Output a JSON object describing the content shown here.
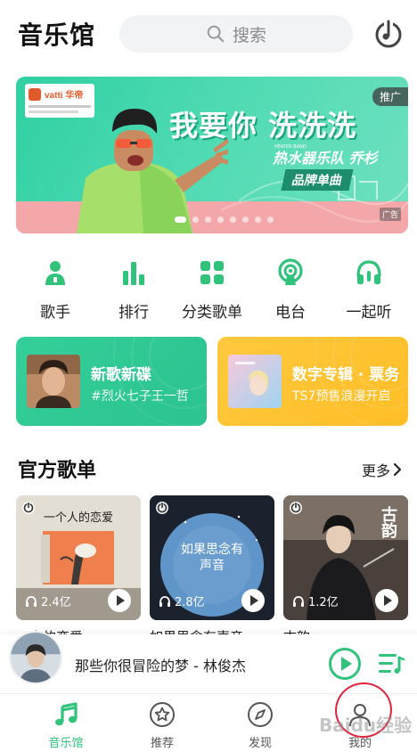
{
  "header": {
    "title": "音乐馆",
    "search_placeholder": "搜索",
    "search_icon": "search-icon",
    "recognize_icon": "music-recognize-icon"
  },
  "banner": {
    "brand": "vatti 华帝",
    "headline": "我要你 洗洗洗",
    "subline": "热水器乐队 乔杉",
    "subline_small": "HEATER BAND",
    "ribbon": "品牌单曲",
    "promo_tag": "推广",
    "ad_tag": "广告",
    "total_slides": 8,
    "active_slide": 0
  },
  "shortcuts": [
    {
      "label": "歌手",
      "icon": "singer-icon"
    },
    {
      "label": "排行",
      "icon": "ranking-icon"
    },
    {
      "label": "分类歌单",
      "icon": "category-icon"
    },
    {
      "label": "电台",
      "icon": "radio-icon"
    },
    {
      "label": "一起听",
      "icon": "listen-together-icon"
    }
  ],
  "features": [
    {
      "title": "新歌新碟",
      "subtitle": "#烈火七子王一哲",
      "color": "#2fc994"
    },
    {
      "title": "数字专辑 · 票务",
      "subtitle": "TS7预售浪漫开启",
      "color": "#ffc530"
    }
  ],
  "official_playlists": {
    "title": "官方歌单",
    "more": "更多",
    "items": [
      {
        "name": "一人的恋爱",
        "art_text": "一个人的恋爱",
        "plays": "2.4亿"
      },
      {
        "name": "如果思念有声音",
        "art_text": "如果思念有声音",
        "plays": "2.8亿"
      },
      {
        "name": "古韵",
        "art_text": "古韵",
        "plays": "1.2亿"
      }
    ]
  },
  "mini_player": {
    "title": "那些你很冒险的梦 - 林俊杰"
  },
  "tabbar": {
    "tabs": [
      {
        "label": "音乐馆",
        "icon": "music-note-icon",
        "active": true
      },
      {
        "label": "推荐",
        "icon": "star-icon",
        "active": false
      },
      {
        "label": "发现",
        "icon": "compass-icon",
        "active": false
      },
      {
        "label": "我的",
        "icon": "profile-icon",
        "active": false
      }
    ]
  },
  "watermark": "Baidu经验",
  "colors": {
    "accent": "#31c27c",
    "annotation": "#e0233a"
  }
}
